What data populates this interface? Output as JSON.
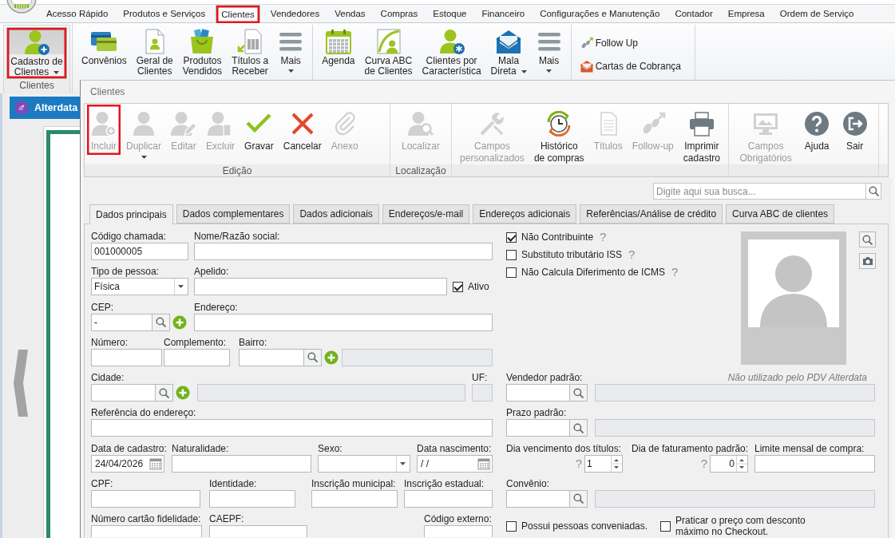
{
  "menu": {
    "tabs": [
      {
        "label": "Acesso Rápido",
        "selected": false,
        "highlighted": false
      },
      {
        "label": "Produtos e Serviços",
        "selected": false,
        "highlighted": false
      },
      {
        "label": "Clientes",
        "selected": true,
        "highlighted": true
      },
      {
        "label": "Vendedores",
        "selected": false,
        "highlighted": false
      },
      {
        "label": "Vendas",
        "selected": false,
        "highlighted": false
      },
      {
        "label": "Compras",
        "selected": false,
        "highlighted": false
      },
      {
        "label": "Estoque",
        "selected": false,
        "highlighted": false
      },
      {
        "label": "Financeiro",
        "selected": false,
        "highlighted": false
      },
      {
        "label": "Configurações e Manutenção",
        "selected": false,
        "highlighted": false
      },
      {
        "label": "Contador",
        "selected": false,
        "highlighted": false
      },
      {
        "label": "Empresa",
        "selected": false,
        "highlighted": false
      },
      {
        "label": "Ordem de Serviço",
        "selected": false,
        "highlighted": false
      }
    ]
  },
  "ribbon": {
    "groups": [
      {
        "kind": "large",
        "label": "Clientes",
        "items": [
          {
            "label": "Cadastro de\nClientes",
            "dropdown": true,
            "selected": true,
            "highlighted": true
          }
        ]
      },
      {
        "kind": "large",
        "items": [
          {
            "label": "Convênios",
            "dropdown": false,
            "selected": false,
            "highlighted": false
          },
          {
            "label": "Geral de\nClientes",
            "dropdown": false,
            "selected": false,
            "highlighted": false
          },
          {
            "label": "Produtos\nVendidos",
            "dropdown": false,
            "selected": false,
            "highlighted": false
          },
          {
            "label": "Títulos a\nReceber",
            "dropdown": false,
            "selected": false,
            "highlighted": false
          },
          {
            "label": "Mais",
            "dropdown": true,
            "selected": false,
            "highlighted": false
          }
        ]
      },
      {
        "kind": "large",
        "items": [
          {
            "label": "Agenda",
            "dropdown": false,
            "selected": false,
            "highlighted": false
          },
          {
            "label": "Curva ABC\nde Clientes",
            "dropdown": false,
            "selected": false,
            "highlighted": false
          },
          {
            "label": "Clientes por\nCaracterística",
            "dropdown": false,
            "selected": false,
            "highlighted": false
          },
          {
            "label": "Mala\nDireta",
            "dropdown": true,
            "selected": false,
            "highlighted": false
          },
          {
            "label": "Mais",
            "dropdown": true,
            "selected": false,
            "highlighted": false
          }
        ]
      },
      {
        "kind": "small",
        "items": [
          {
            "label": "Follow Up",
            "dropdown": false,
            "selected": false,
            "highlighted": false
          },
          {
            "label": "Cartas de Cobrança",
            "dropdown": false,
            "selected": false,
            "highlighted": false
          }
        ]
      }
    ]
  },
  "side_panel": {
    "tab": "Alterdata"
  },
  "window": {
    "title": "Clientes"
  },
  "toolbar": {
    "groups": [
      {
        "label": "Edição",
        "items": [
          {
            "label": "Incluir",
            "disabled": true,
            "dropdown": false,
            "highlighted": true
          },
          {
            "label": "Duplicar",
            "disabled": true,
            "dropdown": true,
            "highlighted": false
          },
          {
            "label": "Editar",
            "disabled": true,
            "dropdown": false,
            "highlighted": false
          },
          {
            "label": "Excluir",
            "disabled": true,
            "dropdown": false,
            "highlighted": false
          },
          {
            "label": "Gravar",
            "disabled": false,
            "dropdown": false,
            "highlighted": false
          },
          {
            "label": "Cancelar",
            "disabled": false,
            "dropdown": false,
            "highlighted": false
          },
          {
            "label": "Anexo",
            "disabled": true,
            "dropdown": false,
            "highlighted": false
          }
        ]
      },
      {
        "label": "Localização",
        "items": [
          {
            "label": "Localizar",
            "disabled": true,
            "dropdown": false,
            "highlighted": false
          }
        ]
      },
      {
        "items": [
          {
            "label": "Campos\npersonalizados",
            "disabled": true,
            "dropdown": false,
            "highlighted": false
          },
          {
            "label": "Histórico\nde compras",
            "disabled": false,
            "dropdown": false,
            "highlighted": false
          },
          {
            "label": "Títulos",
            "disabled": true,
            "dropdown": false,
            "highlighted": false
          },
          {
            "label": "Follow-up",
            "disabled": true,
            "dropdown": false,
            "highlighted": false
          },
          {
            "label": "Imprimir\ncadastro",
            "disabled": false,
            "dropdown": false,
            "highlighted": false
          }
        ]
      },
      {
        "items": [
          {
            "label": "Campos\nObrigatórios",
            "disabled": true,
            "dropdown": false,
            "highlighted": false
          },
          {
            "label": "Ajuda",
            "disabled": false,
            "dropdown": false,
            "highlighted": false
          },
          {
            "label": "Sair",
            "disabled": false,
            "dropdown": false,
            "highlighted": false
          }
        ]
      }
    ]
  },
  "search": {
    "placeholder": "Digite aqui sua busca..."
  },
  "tabs": [
    {
      "label": "Dados principais",
      "selected": true
    },
    {
      "label": "Dados complementares",
      "selected": false
    },
    {
      "label": "Dados adicionais",
      "selected": false
    },
    {
      "label": "Endereços/e-mail",
      "selected": false
    },
    {
      "label": "Endereços adicionais",
      "selected": false
    },
    {
      "label": "Referências/Análise de crédito",
      "selected": false
    },
    {
      "label": "Curva ABC de clientes",
      "selected": false
    }
  ],
  "form": {
    "rows": [
      [
        {
          "kind": "text",
          "label": "Código chamada:",
          "value": "001000005"
        },
        {
          "kind": "text",
          "label": "Nome/Razão social:"
        }
      ],
      [
        {
          "kind": "dropdown",
          "label": "Tipo de pessoa:",
          "value": "Física"
        },
        {
          "kind": "text",
          "label": "Apelido:"
        },
        {
          "kind": "checkbox",
          "label": "Ativo",
          "checked": true
        }
      ],
      [
        {
          "kind": "lookup",
          "label": "CEP:",
          "value": "-",
          "add": true
        },
        {
          "kind": "text",
          "label": "Endereço:"
        }
      ],
      [
        {
          "kind": "text",
          "label": "Número:"
        },
        {
          "kind": "text",
          "label": "Complemento:"
        },
        {
          "kind": "lookup",
          "label": "Bairro:",
          "add": true
        },
        {
          "kind": "readonly"
        }
      ],
      [
        {
          "kind": "lookup",
          "label": "Cidade:",
          "add": true
        },
        {
          "kind": "readonly"
        },
        {
          "kind": "readonly",
          "label": "UF:"
        }
      ],
      [
        {
          "kind": "text",
          "label": "Referência do endereço:"
        }
      ],
      [
        {
          "kind": "date",
          "label": "Data de cadastro:",
          "value": "24/04/2026"
        },
        {
          "kind": "text",
          "label": "Naturalidade:"
        },
        {
          "kind": "dropdown",
          "label": "Sexo:"
        },
        {
          "kind": "date",
          "label": "Data nascimento:",
          "value": "/ /"
        }
      ],
      [
        {
          "kind": "text",
          "label": "CPF:"
        },
        {
          "kind": "text",
          "label": "Identidade:"
        },
        {
          "kind": "text",
          "label": "Inscrição municipal:"
        },
        {
          "kind": "text",
          "label": "Inscrição estadual:"
        }
      ],
      [
        {
          "kind": "text",
          "label": "Número cartão fidelidade:"
        },
        {
          "kind": "text",
          "label": "CAEPF:"
        },
        {
          "kind": "text",
          "label": "Código externo:"
        }
      ]
    ],
    "flags": [
      {
        "label": "Não Contribuinte",
        "checked": true,
        "help": "?"
      },
      {
        "label": "Substituto tributário ISS",
        "checked": false,
        "help": "?"
      },
      {
        "label": "Não Calcula Diferimento de ICMS",
        "checked": false,
        "help": "?"
      }
    ],
    "side_rows": [
      [
        {
          "kind": "lookup",
          "label": "Vendedor padrão:",
          "add": false
        },
        {
          "kind": "readonly",
          "note": "Não utilizado pelo PDV Alterdata"
        }
      ],
      [
        {
          "kind": "lookup",
          "label": "Prazo padrão:",
          "add": false
        },
        {
          "kind": "readonly"
        }
      ],
      [
        {
          "kind": "spin",
          "label": "Dia vencimento dos títulos:",
          "help": "?",
          "value": "1"
        },
        {
          "kind": "spin",
          "label": "Dia de faturamento padrão:",
          "help": "?",
          "value": "0"
        },
        {
          "kind": "text",
          "label": "Limite mensal de compra:"
        }
      ],
      [
        {
          "kind": "lookup",
          "label": "Convênio:",
          "add": false
        },
        {
          "kind": "readonly"
        }
      ],
      [
        {
          "kind": "checkbox",
          "label": "Possui pessoas conveniadas.",
          "checked": false
        },
        {
          "kind": "checkbox",
          "label": "Praticar o preço com desconto máximo no Checkout.",
          "checked": false
        }
      ]
    ]
  }
}
